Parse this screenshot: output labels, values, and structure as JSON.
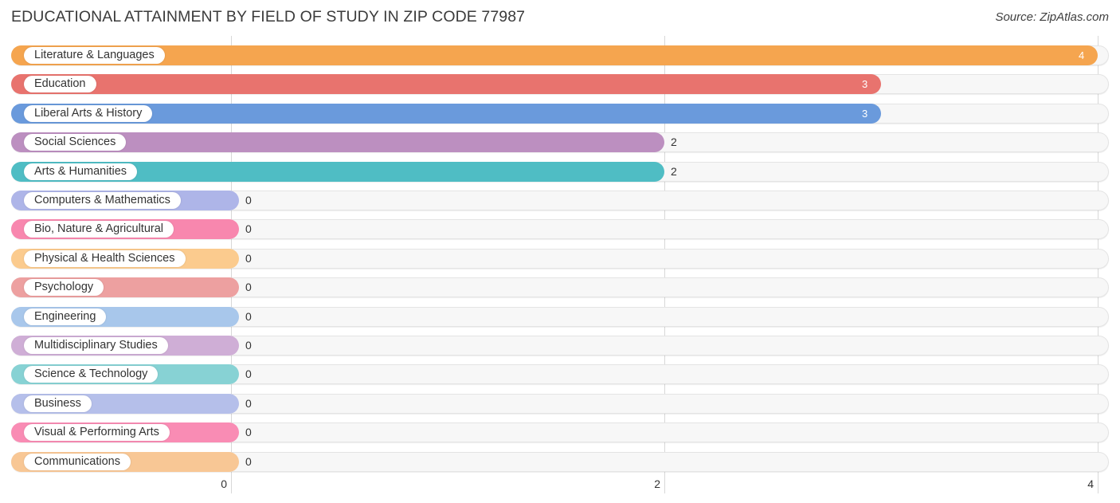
{
  "header": {
    "title": "EDUCATIONAL ATTAINMENT BY FIELD OF STUDY IN ZIP CODE 77987",
    "source": "Source: ZipAtlas.com"
  },
  "chart_data": {
    "type": "bar",
    "orientation": "horizontal",
    "title": "EDUCATIONAL ATTAINMENT BY FIELD OF STUDY IN ZIP CODE 77987",
    "xlabel": "",
    "ylabel": "",
    "xlim": [
      0,
      4
    ],
    "xticks": [
      "0",
      "2",
      "4"
    ],
    "xtick_values": [
      0,
      2,
      4
    ],
    "grid": true,
    "legend": null,
    "categories": [
      "Literature & Languages",
      "Education",
      "Liberal Arts & History",
      "Social Sciences",
      "Arts & Humanities",
      "Computers & Mathematics",
      "Bio, Nature & Agricultural",
      "Physical & Health Sciences",
      "Psychology",
      "Engineering",
      "Multidisciplinary Studies",
      "Science & Technology",
      "Business",
      "Visual & Performing Arts",
      "Communications"
    ],
    "values": [
      4,
      3,
      3,
      2,
      2,
      0,
      0,
      0,
      0,
      0,
      0,
      0,
      0,
      0,
      0
    ],
    "value_labels": [
      "4",
      "3",
      "3",
      "2",
      "2",
      "0",
      "0",
      "0",
      "0",
      "0",
      "0",
      "0",
      "0",
      "0",
      "0"
    ],
    "colors": [
      "#f5a54f",
      "#e8736e",
      "#6a9adc",
      "#bc8fc0",
      "#4fbdc4",
      "#aeb5e8",
      "#f887ae",
      "#fbcb8e",
      "#eda0a0",
      "#a8c7eb",
      "#cfaed6",
      "#87d2d4",
      "#b5bfea",
      "#f98cb4",
      "#f8c795"
    ]
  },
  "axis": {
    "ticks": [
      "0",
      "2",
      "4"
    ]
  }
}
